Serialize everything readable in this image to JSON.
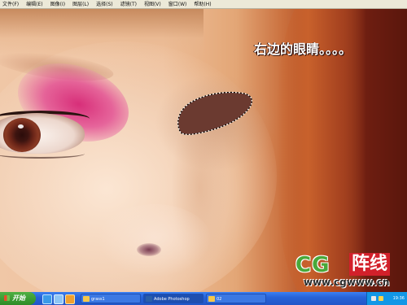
{
  "menu": [
    "文件(F)",
    "编辑(E)",
    "图像(I)",
    "图层(L)",
    "选择(S)",
    "滤镜(T)",
    "视图(V)",
    "窗口(W)",
    "帮助(H)"
  ],
  "caption": "右边的眼睛。。。。",
  "logo": {
    "cg": "CG",
    "name": "阵线",
    "url": "www.cgwww.cn"
  },
  "taskbar": {
    "start_label": "开始",
    "quick_launch": [
      "ie-icon",
      "desktop-icon",
      "media-icon"
    ],
    "tasks": [
      {
        "label": "grass1",
        "active": false
      },
      {
        "label": "Adobe Photoshop",
        "active": true
      },
      {
        "label": "02",
        "active": false
      }
    ],
    "clock": "19:36"
  },
  "colors": {
    "selection_fill": "#6b3a30",
    "taskbar": "#2763d8",
    "start": "#3a9a32"
  }
}
